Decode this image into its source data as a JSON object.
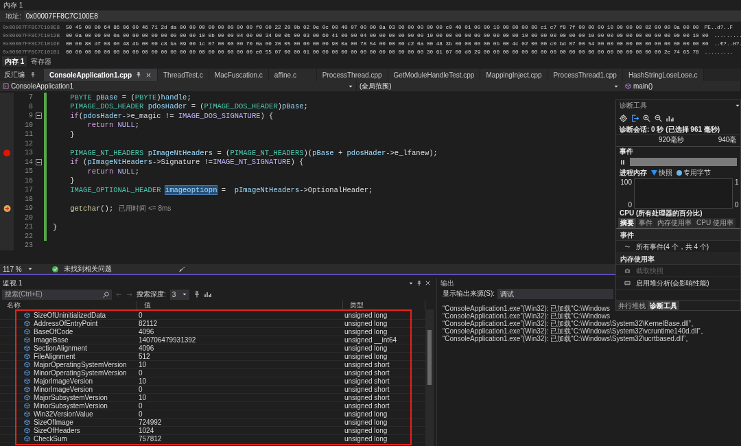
{
  "memory": {
    "title": "内存 1",
    "address_label": "地址:",
    "address": "0x00007FF8C7C100E8",
    "rows": [
      {
        "address": "0x00007FF8C7C100E8",
        "bytes": "50 45 00 00 64 86 06 00 46 71 2d da 00 00 00 00 00 00 00 00 f0 00 22 20 0b 02 0e 0c 00 40 07 00 00 8a 03 00 00 00 00 00 c0 40 01 00 00 10 00 00 00 00 c1 c7 f8 7f 00 00 00 10 00 00 00 02 00 00 0a 00 00",
        "ascii": "PE..d?..F"
      },
      {
        "address": "0x00007FF8C7C1012B",
        "bytes": "00 0a 00 00 00 0a 00 00 00 00 00 00 00 00 10 0b 00 00 04 00 00 34 90 0b 00 03 00 60 41 00 00 04 00 00 00 00 00 00 10 00 00 00 00 00 00 00 00 00 10 00 00 00 00 00 00 10 00 00 00 00 00 00 00 00 00 00 10 00",
        "ascii": "........."
      },
      {
        "address": "0x00007FF8C7C1016E",
        "bytes": "00 00 80 df 08 00 48 db 00 00 c8 ba 09 00 1c 07 00 00 00 f0 0a 00 20 05 00 00 00 00 90 0a 00 78 54 00 00 00 c2 0a 00 48 3b 00 00 00 00 0b 00 4c 02 00 00 c0 bd 07 00 54 00 00 00 00 00 00 00 00 00 00 00 00",
        "ascii": "..€?..H?."
      },
      {
        "address": "0x00007FF8C7C101B1",
        "bytes": "00 00 00 00 00 00 00 00 00 00 00 00 00 00 00 00 00 00 00 00 e0 55 07 00 00 01 00 00 00 00 00 00 00 00 00 00 00 00 30 61 07 00 d0 29 00 00 00 00 00 00 00 00 00 00 00 00 00 00 00 00 00 00 00 2e 74 65 78",
        "ascii": "........."
      }
    ],
    "tabs": [
      {
        "label": "内存 1",
        "selected": true
      },
      {
        "label": "寄存器",
        "selected": false
      }
    ]
  },
  "editor": {
    "tool_tab": "反汇编",
    "tabs": [
      {
        "label": "ConsoleApplication1.cpp",
        "selected": true
      },
      {
        "label": "ThreadTest.c",
        "selected": false
      },
      {
        "label": "MacFuscation.c",
        "selected": false
      },
      {
        "label": "affine.c",
        "selected": false
      },
      {
        "label": "ProcessThread.cpp",
        "selected": false
      },
      {
        "label": "GetModuleHandleTest.cpp",
        "selected": false
      },
      {
        "label": "MappingInject.cpp",
        "selected": false
      },
      {
        "label": "ProcessThread1.cpp",
        "selected": false
      },
      {
        "label": "HashStringLoseLose.c",
        "selected": false
      }
    ],
    "project": "ConsoleApplication1",
    "scope": "(全局范围)",
    "member": "main()",
    "lines": [
      {
        "number": "7",
        "breakpoint": false,
        "current": false,
        "fold": false,
        "segments": [
          {
            "text": "    PBYTE",
            "kind": "type"
          },
          {
            "text": " pBase",
            "kind": "var"
          },
          {
            "text": " = (",
            "kind": "plain"
          },
          {
            "text": "PBYTE",
            "kind": "type"
          },
          {
            "text": ")",
            "kind": "plain"
          },
          {
            "text": "handle",
            "kind": "var"
          },
          {
            "text": ";",
            "kind": "plain"
          }
        ]
      },
      {
        "number": "8",
        "breakpoint": false,
        "current": false,
        "fold": false,
        "segments": [
          {
            "text": "    PIMAGE_DOS_HEADER",
            "kind": "type"
          },
          {
            "text": " pdosHader",
            "kind": "var"
          },
          {
            "text": " = (",
            "kind": "plain"
          },
          {
            "text": "PIMAGE_DOS_HEADER",
            "kind": "type"
          },
          {
            "text": ")",
            "kind": "plain"
          },
          {
            "text": "pBase",
            "kind": "var"
          },
          {
            "text": ";",
            "kind": "plain"
          }
        ]
      },
      {
        "number": "9",
        "breakpoint": false,
        "current": false,
        "fold": true,
        "segments": [
          {
            "text": "    if",
            "kind": "keyword"
          },
          {
            "text": "(",
            "kind": "plain"
          },
          {
            "text": "pdosHader",
            "kind": "var"
          },
          {
            "text": "->e_magic != ",
            "kind": "plain"
          },
          {
            "text": "IMAGE_DOS_SIGNATURE",
            "kind": "macro"
          },
          {
            "text": ") {",
            "kind": "plain"
          }
        ]
      },
      {
        "number": "10",
        "breakpoint": false,
        "current": false,
        "fold": false,
        "segments": [
          {
            "text": "        return",
            "kind": "keyword"
          },
          {
            "text": " NULL",
            "kind": "macro"
          },
          {
            "text": ";",
            "kind": "plain"
          }
        ]
      },
      {
        "number": "11",
        "breakpoint": false,
        "current": false,
        "fold": false,
        "segments": [
          {
            "text": "    }",
            "kind": "plain"
          }
        ]
      },
      {
        "number": "12",
        "breakpoint": false,
        "current": false,
        "fold": false
      },
      {
        "number": "13",
        "breakpoint": true,
        "current": false,
        "fold": false,
        "segments": [
          {
            "text": "    PIMAGE_NT_HEADERS",
            "kind": "type"
          },
          {
            "text": " pImageNtHeaders",
            "kind": "var"
          },
          {
            "text": " = (",
            "kind": "plain"
          },
          {
            "text": "PIMAGE_NT_HEADERS",
            "kind": "type"
          },
          {
            "text": ")(",
            "kind": "plain"
          },
          {
            "text": "pBase",
            "kind": "var"
          },
          {
            "text": " + ",
            "kind": "plain"
          },
          {
            "text": "pdosHader",
            "kind": "var"
          },
          {
            "text": "->e_lfanew);",
            "kind": "plain"
          }
        ]
      },
      {
        "number": "14",
        "breakpoint": false,
        "current": false,
        "fold": true,
        "segments": [
          {
            "text": "    if",
            "kind": "keyword"
          },
          {
            "text": " (",
            "kind": "plain"
          },
          {
            "text": "pImageNtHeaders",
            "kind": "var"
          },
          {
            "text": "->Signature !=",
            "kind": "plain"
          },
          {
            "text": "IMAGE_NT_SIGNATURE",
            "kind": "macro"
          },
          {
            "text": ") {",
            "kind": "plain"
          }
        ]
      },
      {
        "number": "15",
        "breakpoint": false,
        "current": false,
        "fold": false,
        "segments": [
          {
            "text": "        return",
            "kind": "keyword"
          },
          {
            "text": " NULL",
            "kind": "macro"
          },
          {
            "text": ";",
            "kind": "plain"
          }
        ]
      },
      {
        "number": "16",
        "breakpoint": false,
        "current": false,
        "fold": false,
        "segments": [
          {
            "text": "    }",
            "kind": "plain"
          }
        ]
      },
      {
        "number": "17",
        "breakpoint": false,
        "current": false,
        "fold": false,
        "segments": [
          {
            "text": "    IMAGE_OPTIONAL_HEADER ",
            "kind": "type"
          },
          {
            "text": "imageoptiopn",
            "kind": "selection"
          },
          {
            "text": " =  ",
            "kind": "plain"
          },
          {
            "text": "pImageNtHeaders",
            "kind": "var"
          },
          {
            "text": "->OptionalHeader;",
            "kind": "plain"
          }
        ]
      },
      {
        "number": "18",
        "breakpoint": false,
        "current": false,
        "fold": false
      },
      {
        "number": "19",
        "breakpoint": false,
        "current": true,
        "fold": false,
        "segments": [
          {
            "text": "    getchar",
            "kind": "function"
          },
          {
            "text": "();",
            "kind": "plain"
          }
        ],
        "hint": "已用时间 <= 8ms"
      },
      {
        "number": "20",
        "breakpoint": false,
        "current": false,
        "fold": false
      },
      {
        "number": "21",
        "breakpoint": false,
        "current": false,
        "fold": false,
        "segments": [
          {
            "text": "}",
            "kind": "plain"
          }
        ]
      },
      {
        "number": "22",
        "breakpoint": false,
        "current": false,
        "fold": false
      },
      {
        "number": "23",
        "breakpoint": false,
        "current": false,
        "fold": false
      }
    ],
    "zoom": "117 %",
    "issues": "未找到相关问题"
  },
  "watch": {
    "title": "监视 1",
    "placeholder": "搜索(Ctrl+E)",
    "depth_label": "搜索深度:",
    "depth": "3",
    "columns": [
      "名称",
      "值",
      "类型"
    ],
    "rows": [
      {
        "name": "SizeOfUninitializedData",
        "value": "0",
        "type": "unsigned long"
      },
      {
        "name": "AddressOfEntryPoint",
        "value": "82112",
        "type": "unsigned long"
      },
      {
        "name": "BaseOfCode",
        "value": "4096",
        "type": "unsigned long"
      },
      {
        "name": "ImageBase",
        "value": "140706479931392",
        "type": "unsigned __int64"
      },
      {
        "name": "SectionAlignment",
        "value": "4096",
        "type": "unsigned long"
      },
      {
        "name": "FileAlignment",
        "value": "512",
        "type": "unsigned long"
      },
      {
        "name": "MajorOperatingSystemVersion",
        "value": "10",
        "type": "unsigned short"
      },
      {
        "name": "MinorOperatingSystemVersion",
        "value": "0",
        "type": "unsigned short"
      },
      {
        "name": "MajorImageVersion",
        "value": "10",
        "type": "unsigned short"
      },
      {
        "name": "MinorImageVersion",
        "value": "0",
        "type": "unsigned short"
      },
      {
        "name": "MajorSubsystemVersion",
        "value": "10",
        "type": "unsigned short"
      },
      {
        "name": "MinorSubsystemVersion",
        "value": "0",
        "type": "unsigned short"
      },
      {
        "name": "Win32VersionValue",
        "value": "0",
        "type": "unsigned long"
      },
      {
        "name": "SizeOfImage",
        "value": "724992",
        "type": "unsigned long"
      },
      {
        "name": "SizeOfHeaders",
        "value": "1024",
        "type": "unsigned long"
      },
      {
        "name": "CheckSum",
        "value": "757812",
        "type": "unsigned long"
      }
    ]
  },
  "output": {
    "title": "输出",
    "source_label": "显示输出来源(S):",
    "source": "调试",
    "lines": [
      "“ConsoleApplication1.exe”(Win32): 已加载“C:\\Windows",
      "“ConsoleApplication1.exe”(Win32): 已加载“C:\\Windows",
      "“ConsoleApplication1.exe”(Win32): 已加载“C:\\Windows\\System32\\KernelBase.dll”。",
      "“ConsoleApplication1.exe”(Win32): 已加载“C:\\Windows\\System32\\vcruntime140d.dll”。",
      "“ConsoleApplication1.exe”(Win32): 已加载“C:\\Windows\\System32\\ucrtbased.dll”。"
    ]
  },
  "diagnostics": {
    "title": "诊断工具",
    "session": "诊断会话: 0 秒 (已选择 961 毫秒)",
    "ruler_labels": [
      "920毫秒",
      "940毫"
    ],
    "events_header": "事件",
    "memory_header": "进程内存",
    "legend": [
      {
        "label": "快照",
        "kind": "triangle"
      },
      {
        "label": "专用字节",
        "kind": "dot"
      }
    ],
    "chart_left_ticks": [
      "100",
      "0"
    ],
    "chart_right_ticks": [
      "1",
      "0"
    ],
    "cpu_header": "CPU (所有处理器的百分比)",
    "tabs": [
      {
        "label": "摘要",
        "selected": true
      },
      {
        "label": "事件",
        "selected": false
      },
      {
        "label": "内存使用率",
        "selected": false
      },
      {
        "label": "CPU 使用率",
        "selected": false
      }
    ],
    "sections": [
      {
        "title": "事件",
        "items": [
          {
            "label": "所有事件(4 个，共 4 个)",
            "kind": "events",
            "disabled": false
          }
        ]
      },
      {
        "title": "内存使用率",
        "items": [
          {
            "label": "截取快照",
            "kind": "camera",
            "disabled": true
          },
          {
            "label": "启用堆分析(会影响性能)",
            "kind": "heap",
            "disabled": false
          }
        ]
      }
    ],
    "bottom_tabs": [
      {
        "label": "并行堆栈",
        "selected": false
      },
      {
        "label": "诊断工具",
        "selected": true
      }
    ]
  }
}
